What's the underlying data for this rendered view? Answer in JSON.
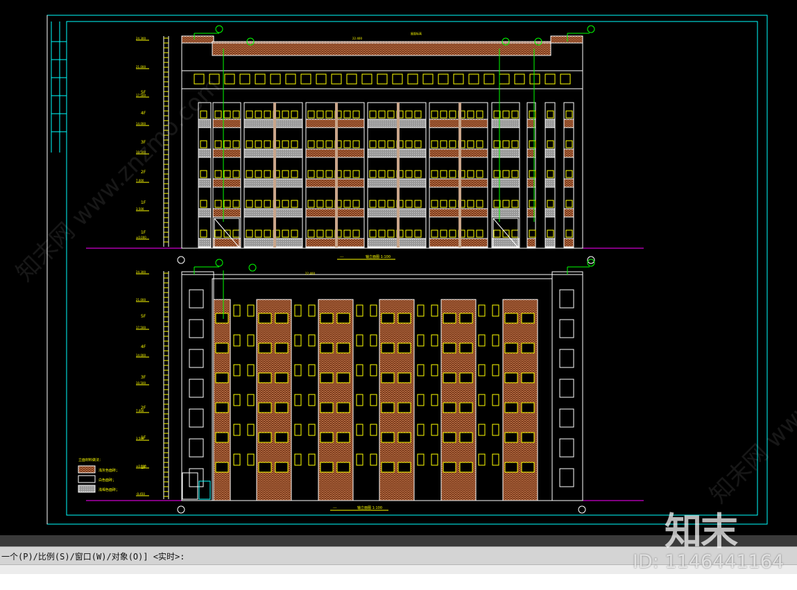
{
  "drawing": {
    "top_elevation": {
      "title": "轴立面图",
      "scale": "1:100",
      "dimension_top": "22.400",
      "note_label": "屋面标高",
      "floor_labels": [
        "5F",
        "4F",
        "3F",
        "2F",
        "1F",
        "1F"
      ],
      "level_labels": [
        "24.300",
        "21.000",
        "17.500",
        "14.000",
        "10.500",
        "7.000",
        "3.500",
        "±0.000"
      ]
    },
    "bottom_elevation": {
      "title": "轴立面图",
      "scale": "1:100",
      "dimension_top": "22.400",
      "floor_labels": [
        "5F",
        "4F",
        "3F",
        "2F",
        "1F",
        "1F"
      ],
      "level_labels": [
        "24.300",
        "21.000",
        "17.500",
        "14.000",
        "10.500",
        "7.000",
        "3.500",
        "±0.000",
        "-0.450"
      ]
    },
    "legend": {
      "title": "立面材料做法：",
      "items": [
        "浅灰色面砖；",
        "白色面砖；",
        "浅褐色面砖；"
      ]
    },
    "colors": {
      "frame": "#00ffff",
      "line": "#ffffff",
      "window": "#ffff00",
      "brick": "#a0522d",
      "leader": "#00ff00",
      "ground": "#ff00ff",
      "gray_panel": "#b8b8b8"
    }
  },
  "command_line": {
    "text": "一个(P)/比例(S)/窗口(W)/对象(O)] <实时>:"
  },
  "watermark": {
    "logo": "知末",
    "id": "ID: 1146441164",
    "diagonal": "知末网 www.znzmo.com"
  }
}
